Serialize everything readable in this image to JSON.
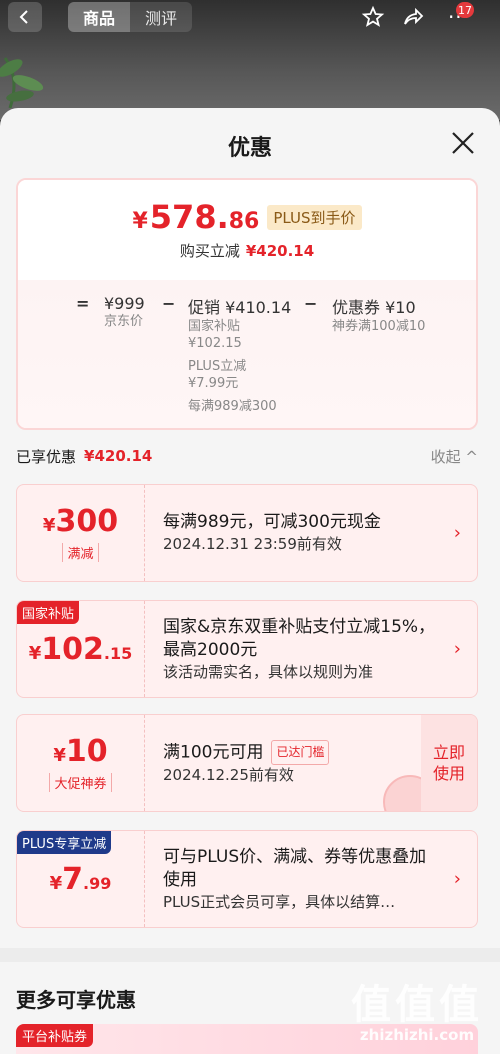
{
  "top_tabs": [
    {
      "label": "商品"
    },
    {
      "label": "测评"
    }
  ],
  "notif_count": "17",
  "sheet": {
    "title": "优惠"
  },
  "summary": {
    "price_symbol": "¥",
    "price_int": "578.",
    "price_dec": "86",
    "plus_tag": "PLUS到手价",
    "buy_reduce_label": "购买立减",
    "buy_reduce_amount": "¥420.14",
    "calc": {
      "eq": "=",
      "jd_price": "¥999",
      "jd_price_label": "京东价",
      "minus1": "−",
      "promo": "促销 ¥410.14",
      "promo_lines": [
        "国家补贴",
        "¥102.15",
        "PLUS立减",
        "¥7.99元",
        "每满989减300"
      ],
      "minus2": "−",
      "coupon": "优惠券 ¥10",
      "coupon_sub": "神券满100减10"
    }
  },
  "enjoyed": {
    "label": "已享优惠",
    "amount": "¥420.14",
    "collapse": "收起 ^"
  },
  "coupons": [
    {
      "symbol": "¥",
      "int": "300",
      "dec": "",
      "type": "满减",
      "main": "每满989元，可减300元现金",
      "sub": "2024.12.31 23:59前有效"
    },
    {
      "corner": "国家补贴",
      "symbol": "¥",
      "int": "102",
      "dec": ".15",
      "main": "国家&京东双重补贴支付立减15%，最高2000元",
      "sub": "该活动需实名，具体以规则为准"
    },
    {
      "symbol": "¥",
      "int": "10",
      "dec": "",
      "type": "大促神券",
      "main": "满100元可用",
      "reached": "已达门槛",
      "sub": "2024.12.25前有效",
      "use_line1": "立即",
      "use_line2": "使用"
    },
    {
      "corner": "PLUS专享立减",
      "symbol": "¥",
      "int": "7",
      "dec": ".99",
      "main": "可与PLUS价、满减、券等优惠叠加使用",
      "sub": "PLUS正式会员可享，具体以结算…"
    }
  ],
  "more": {
    "title": "更多可享优惠",
    "tag": "平台补贴券"
  },
  "watermark": {
    "glyphs": "值值值",
    "text": "zhizhizhi.com"
  },
  "colors": {
    "accent_red": "#e4232a",
    "plus_gold_bg": "#fbe9c8",
    "plus_blue": "#1f3a8a"
  }
}
